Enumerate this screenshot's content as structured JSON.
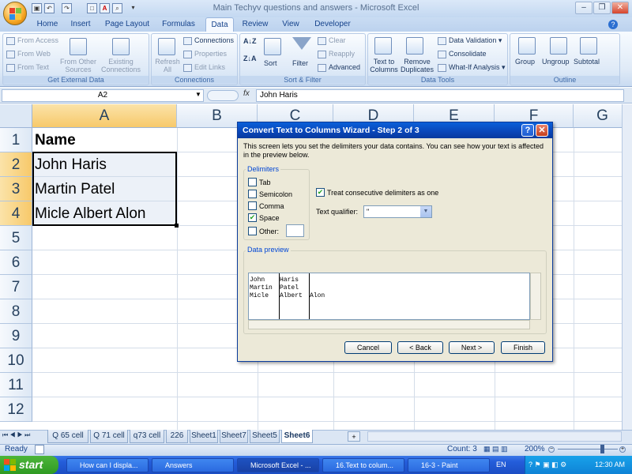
{
  "window": {
    "title": "Main Techyv questions and answers - Microsoft Excel"
  },
  "tabs": [
    "Home",
    "Insert",
    "Page Layout",
    "Formulas",
    "Data",
    "Review",
    "View",
    "Developer"
  ],
  "ribbon": {
    "get_external": {
      "items": [
        "From Access",
        "From Web",
        "From Text",
        "From Other Sources",
        "Existing Connections",
        "Refresh All"
      ],
      "label": "Get External Data"
    },
    "connections": {
      "items": [
        "Connections",
        "Properties",
        "Edit Links"
      ],
      "label": "Connections"
    },
    "sort_filter": {
      "items": [
        "Sort",
        "Filter",
        "Clear",
        "Reapply",
        "Advanced"
      ],
      "label": "Sort & Filter"
    },
    "data_tools": {
      "items": [
        "Text to Columns",
        "Remove Duplicates",
        "Data Validation",
        "Consolidate",
        "What-If Analysis"
      ],
      "label": "Data Tools"
    },
    "outline": {
      "items": [
        "Group",
        "Ungroup",
        "Subtotal"
      ],
      "label": "Outline"
    }
  },
  "formula_bar": {
    "name_box": "A2",
    "fx": "fx",
    "value": "John Haris"
  },
  "columns": [
    "A",
    "B",
    "C",
    "D",
    "E",
    "F",
    "G"
  ],
  "rows": [
    "1",
    "2",
    "3",
    "4",
    "5",
    "6",
    "7",
    "8",
    "9",
    "10",
    "11",
    "12"
  ],
  "cells": {
    "A1": "Name",
    "A2": "John Haris",
    "A3": "Martin Patel",
    "A4": "Micle Albert Alon"
  },
  "dialog": {
    "title": "Convert Text to Columns Wizard - Step 2 of 3",
    "description": "This screen lets you set the delimiters your data contains.  You can see how your text is affected in the preview below.",
    "delimiters_label": "Delimiters",
    "delimiters": [
      {
        "label": "Tab",
        "checked": false
      },
      {
        "label": "Semicolon",
        "checked": false
      },
      {
        "label": "Comma",
        "checked": false
      },
      {
        "label": "Space",
        "checked": true
      },
      {
        "label": "Other:",
        "checked": false
      }
    ],
    "consecutive_label": "Treat consecutive delimiters as one",
    "consecutive_checked": true,
    "qualifier_label": "Text qualifier:",
    "qualifier_value": "\"",
    "preview_label": "Data preview",
    "preview_rows": [
      [
        "John",
        "Haris",
        ""
      ],
      [
        "Martin",
        "Patel",
        ""
      ],
      [
        "Micle",
        "Albert",
        "Alon"
      ]
    ],
    "buttons": {
      "cancel": "Cancel",
      "back": "< Back",
      "next": "Next >",
      "finish": "Finish"
    }
  },
  "sheets": [
    "Q 65 cell",
    "Q 71 cell",
    "q73 cell",
    "226",
    "Sheet1",
    "Sheet7",
    "Sheet5",
    "Sheet6"
  ],
  "active_sheet": "Sheet6",
  "status": {
    "mode": "Ready",
    "count": "Count: 3",
    "zoom": "200%"
  },
  "taskbar": {
    "start": "start",
    "tasks": [
      "How can I displa...",
      "Answers",
      "Microsoft Excel - ...",
      "16.Text to colum...",
      "16-3 - Paint"
    ],
    "lang": "EN",
    "time": "12:30 AM"
  }
}
